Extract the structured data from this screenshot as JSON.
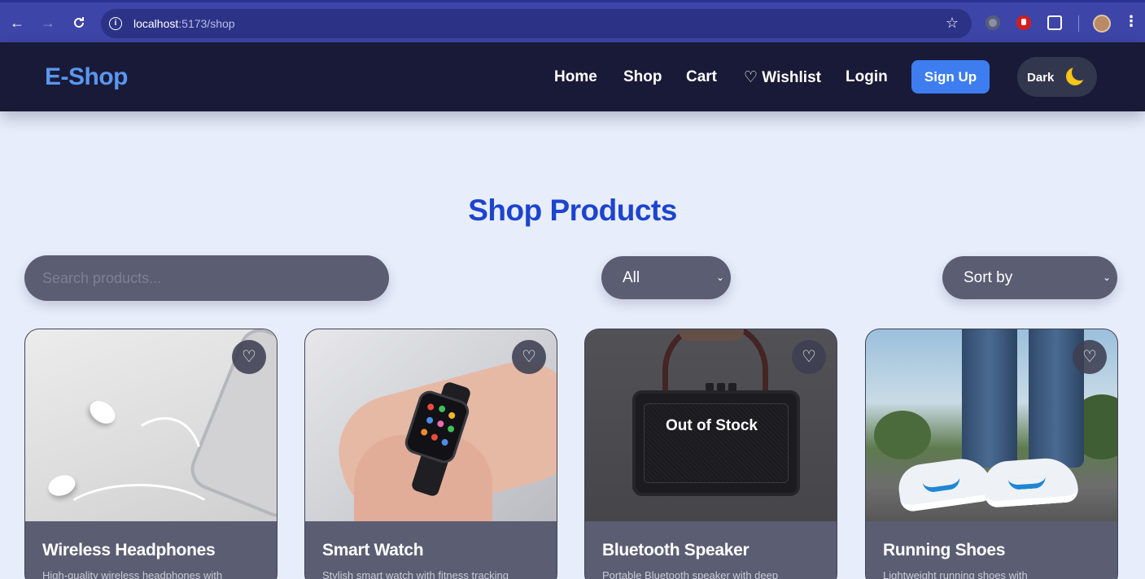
{
  "browser": {
    "url_host": "localhost",
    "url_path": ":5173/shop",
    "back_icon": "←",
    "forward_icon": "→",
    "reload_icon": "C",
    "star_icon": "☆",
    "menu_icon": "⋮"
  },
  "header": {
    "brand": "E-Shop",
    "nav": {
      "home": "Home",
      "shop": "Shop",
      "cart": "Cart",
      "wishlist": "♡ Wishlist",
      "login": "Login"
    },
    "signup_label": "Sign Up",
    "theme_label": "Dark"
  },
  "main": {
    "title": "Shop Products",
    "search_placeholder": "Search products...",
    "category_selected": "All",
    "sort_selected": "Sort by",
    "chevron": "⌄"
  },
  "products": [
    {
      "title": "Wireless Headphones",
      "desc": "High-quality wireless headphones with",
      "in_stock": true
    },
    {
      "title": "Smart Watch",
      "desc": "Stylish smart watch with fitness tracking",
      "in_stock": true
    },
    {
      "title": "Bluetooth Speaker",
      "desc": "Portable Bluetooth speaker with deep",
      "in_stock": false,
      "stock_label": "Out of Stock"
    },
    {
      "title": "Running Shoes",
      "desc": "Lightweight running shoes with",
      "in_stock": true
    }
  ],
  "wishlist_icon": "♡",
  "colors": {
    "accent": "#3d7df0",
    "brand": "#5a96f0",
    "title": "#1d44cf",
    "header_bg": "#191a37"
  }
}
